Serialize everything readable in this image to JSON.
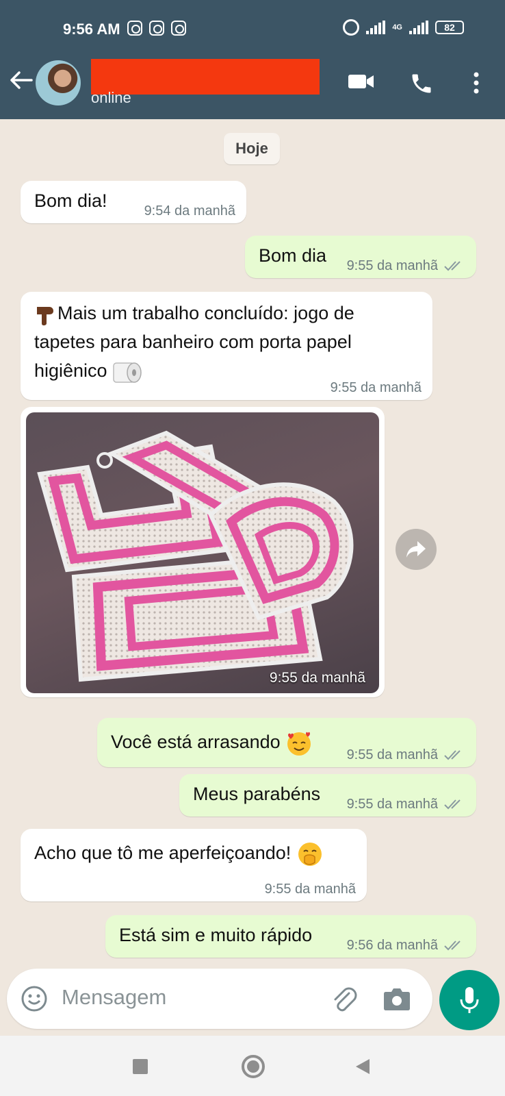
{
  "status_bar": {
    "time": "9:56 AM",
    "network": "4G",
    "battery": "82"
  },
  "header": {
    "contact_status": "online",
    "icons": [
      "back-arrow-icon",
      "video-call-icon",
      "phone-icon",
      "more-vert-icon"
    ]
  },
  "chat": {
    "date_chip": "Hoje",
    "messages": [
      {
        "dir": "in",
        "text": "Bom dia!",
        "time": "9:54 da manhã"
      },
      {
        "dir": "out",
        "text": "Bom dia",
        "time": "9:55 da manhã"
      },
      {
        "dir": "in",
        "line1": "Mais um trabalho concluído: jogo de",
        "line2": "tapetes para banheiro com porta papel",
        "line3": "higiênico",
        "time": "9:55 da manhã"
      },
      {
        "dir": "in",
        "type": "image",
        "time": "9:55 da manhã"
      },
      {
        "dir": "out",
        "text": "Você está arrasando",
        "time": "9:55 da manhã"
      },
      {
        "dir": "out",
        "text": "Meus parabéns",
        "time": "9:55 da manhã"
      },
      {
        "dir": "in",
        "text": "Acho que tô me aperfeiçoando!",
        "time": "9:55 da manhã"
      },
      {
        "dir": "out",
        "text": "Está sim e muito rápido",
        "time": "9:56 da manhã"
      }
    ]
  },
  "input": {
    "placeholder": "Mensagem"
  },
  "colors": {
    "header": "#3c5565",
    "outgoing_bubble": "#e7fbd2",
    "incoming_bubble": "#ffffff",
    "background": "#efe7de",
    "mic_button": "#009b84",
    "redaction": "#f4380f"
  }
}
